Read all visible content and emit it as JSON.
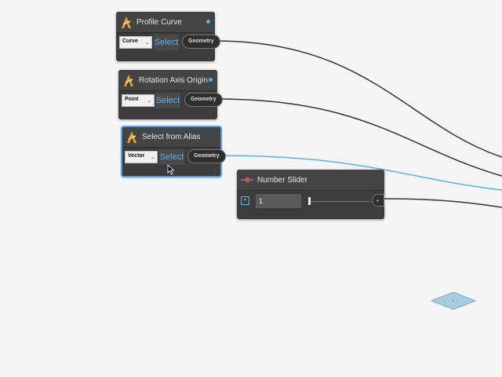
{
  "nodes": {
    "profile_curve": {
      "title": "Profile Curve",
      "dropdown": "Curve",
      "select_label": "Select",
      "output": "Geometry"
    },
    "rotation_axis": {
      "title": "Rotation Axis Origin",
      "dropdown": "Point",
      "select_label": "Select",
      "output": "Geometry"
    },
    "alias": {
      "title": "Select from Alias",
      "dropdown": "Vector",
      "select_label": "Select",
      "output": "Geometry"
    },
    "slider": {
      "title": "Number Slider",
      "value": "1",
      "value_fraction": 0.0
    }
  },
  "colors": {
    "canvas": "#f5f5f5",
    "node_bg": "#3c3c3c",
    "accent": "#4fa3d8",
    "wire": "#333333"
  },
  "icons": {
    "dynamo": "dynamo-logo-icon",
    "slider": "slider-icon",
    "kebab": "kebab-menu-icon",
    "expand": "chevron-down-icon",
    "cursor": "mouse-cursor-icon"
  }
}
